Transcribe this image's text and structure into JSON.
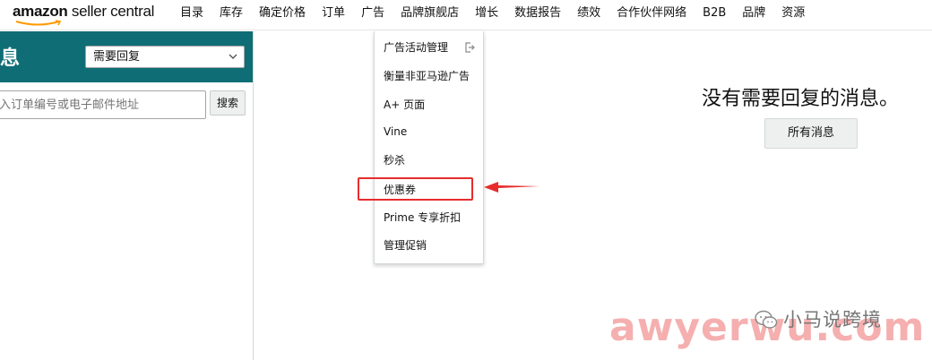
{
  "app": {
    "logo_main": "amazon",
    "logo_sub": " seller central"
  },
  "nav": {
    "items": [
      {
        "label": "目录"
      },
      {
        "label": "库存"
      },
      {
        "label": "确定价格"
      },
      {
        "label": "订单"
      },
      {
        "label": "广告"
      },
      {
        "label": "品牌旗舰店"
      },
      {
        "label": "增长"
      },
      {
        "label": "数据报告"
      },
      {
        "label": "绩效"
      },
      {
        "label": "合作伙伴网络"
      },
      {
        "label": "B2B"
      },
      {
        "label": "品牌"
      },
      {
        "label": "资源"
      }
    ]
  },
  "left": {
    "title": "息",
    "filter_value": "需要回复",
    "search_placeholder": "入订单编号或电子邮件地址",
    "search_button": "搜索"
  },
  "dropdown": {
    "items": [
      {
        "label": "广告活动管理"
      },
      {
        "label": "衡量非亚马逊广告"
      },
      {
        "label": "A+ 页面"
      },
      {
        "label": "Vine"
      },
      {
        "label": "秒杀"
      },
      {
        "label": "优惠券"
      },
      {
        "label": "Prime 专享折扣"
      },
      {
        "label": "管理促销"
      }
    ]
  },
  "main": {
    "empty_title": "没有需要回复的消息。",
    "all_messages_button": "所有消息"
  },
  "watermark": {
    "name": "小马说跨境",
    "site": "awyerwu.com"
  },
  "colors": {
    "header_teal": "#0f6e75",
    "highlight_red": "#e62c2c",
    "logo_orange": "#ff9900"
  }
}
